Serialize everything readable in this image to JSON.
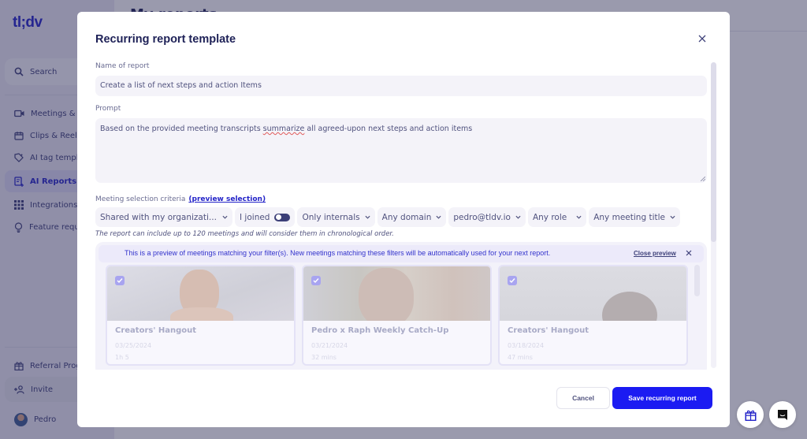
{
  "app": {
    "logo": "tl;dv",
    "page_title_peek": "My reports"
  },
  "sidebar": {
    "search_label": "Search",
    "items": [
      {
        "label": "Meetings & Files",
        "icon": "video-camera-icon"
      },
      {
        "label": "Clips & Reels",
        "icon": "clapperboard-icon"
      },
      {
        "label": "AI tag templates",
        "icon": "tag-sparkle-icon"
      },
      {
        "label": "AI Reports",
        "icon": "report-plus-icon",
        "active": true
      },
      {
        "label": "Integrations",
        "icon": "grid-icon"
      },
      {
        "label": "Feature requests",
        "icon": "lightbulb-icon"
      }
    ],
    "bottom": {
      "referral": "Referral Program",
      "invite": "Invite",
      "user": "Pedro"
    }
  },
  "modal": {
    "title": "Recurring report template",
    "name_label": "Name of report",
    "name_value": "Create a list of next steps and action Items",
    "prompt_label": "Prompt",
    "prompt_before": "Based on the provided meeting transcripts ",
    "prompt_misspelled": "summarize",
    "prompt_after": " all agreed-upon next steps and action items",
    "criteria_label": "Meeting selection criteria",
    "criteria_link": "(preview selection)",
    "filters": {
      "sharing": "Shared with my organizati...",
      "joined": "I joined",
      "joined_toggle_on": true,
      "internals": "Only internals",
      "domain": "Any domain",
      "participant": "pedro@tldv.io",
      "role": "Any role",
      "title": "Any meeting title"
    },
    "note": "The report can include up to 120 meetings and will consider them in chronological order.",
    "preview": {
      "banner": "This is a preview of meetings matching your filter(s). New meetings matching these filters will be automatically used for your next report.",
      "close_label": "Close preview",
      "meetings": [
        {
          "title": "Creators' Hangout",
          "date": "03/25/2024",
          "duration": "1h 5",
          "checked": true
        },
        {
          "title": "Pedro x Raph Weekly Catch-Up",
          "date": "03/21/2024",
          "duration": "32 mins",
          "checked": true
        },
        {
          "title": "Creators' Hangout",
          "date": "03/18/2024",
          "duration": "47 mins",
          "checked": true
        }
      ]
    },
    "cancel_label": "Cancel",
    "save_label": "Save recurring report"
  },
  "colors": {
    "brand": "#2323c8",
    "primary_button": "#1b1bf2",
    "overlay": "#6b6b8e"
  }
}
